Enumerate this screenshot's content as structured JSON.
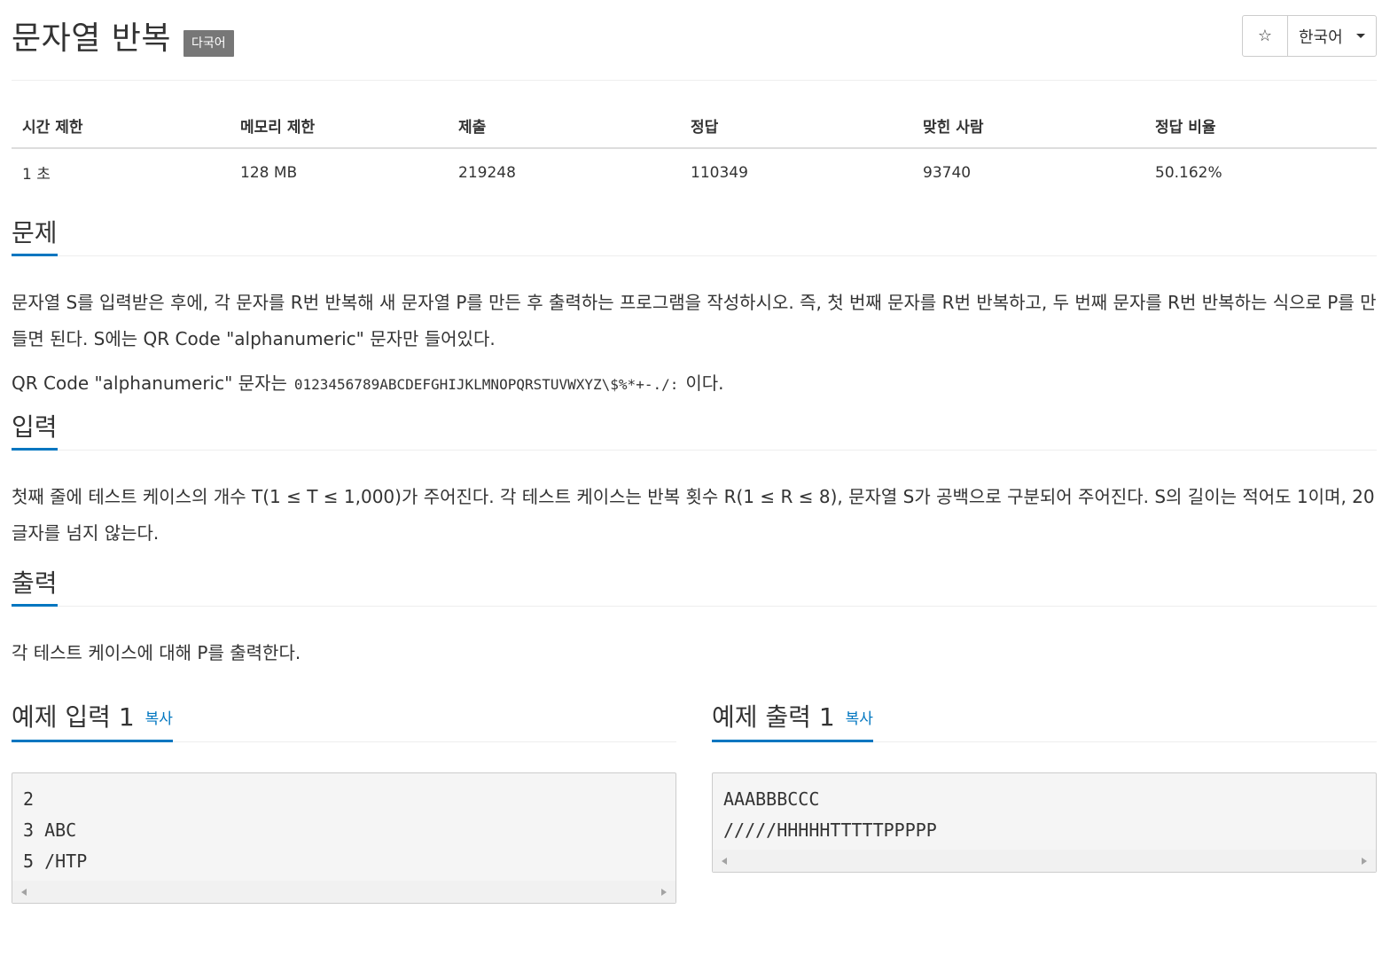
{
  "header": {
    "title": "문자열 반복",
    "badge": "다국어",
    "star_icon": "☆",
    "language": "한국어"
  },
  "info": {
    "headers": [
      "시간 제한",
      "메모리 제한",
      "제출",
      "정답",
      "맞힌 사람",
      "정답 비율"
    ],
    "values": [
      "1 초",
      "128 MB",
      "219248",
      "110349",
      "93740",
      "50.162%"
    ]
  },
  "problem": {
    "heading": "문제",
    "paragraph1": "문자열 S를 입력받은 후에, 각 문자를 R번 반복해 새 문자열 P를 만든 후 출력하는 프로그램을 작성하시오. 즉, 첫 번째 문자를 R번 반복하고, 두 번째 문자를 R번 반복하는 식으로 P를 만들면 된다. S에는 QR Code \"alphanumeric\" 문자만 들어있다.",
    "paragraph2_prefix": "QR Code \"alphanumeric\" 문자는",
    "paragraph2_code": "0123456789ABCDEFGHIJKLMNOPQRSTUVWXYZ\\$%*+-./:",
    "paragraph2_suffix": "이다."
  },
  "input": {
    "heading": "입력",
    "paragraph": "첫째 줄에 테스트 케이스의 개수 T(1 ≤ T ≤ 1,000)가 주어진다. 각 테스트 케이스는 반복 횟수 R(1 ≤ R ≤ 8), 문자열 S가 공백으로 구분되어 주어진다. S의 길이는 적어도 1이며, 20글자를 넘지 않는다."
  },
  "output": {
    "heading": "출력",
    "paragraph": "각 테스트 케이스에 대해 P를 출력한다."
  },
  "samples": {
    "input": {
      "heading": "예제 입력 1",
      "copy": "복사",
      "lines": [
        "2",
        "3 ABC",
        "5 /HTP"
      ]
    },
    "output": {
      "heading": "예제 출력 1",
      "copy": "복사",
      "lines": [
        "AAABBBCCC",
        "/////HHHHHTTTTTPPPPP"
      ]
    }
  }
}
